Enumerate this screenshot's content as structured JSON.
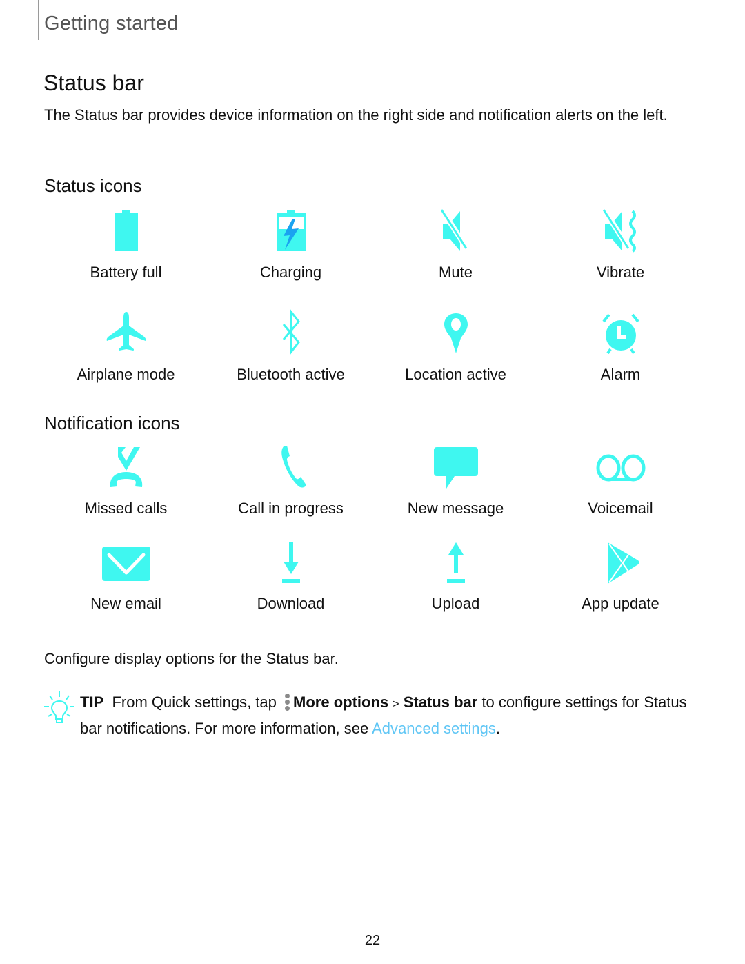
{
  "header": {
    "chapter": "Getting started"
  },
  "page": {
    "title": "Status bar",
    "intro": "The Status bar provides device information on the right side and notification alerts on the left.",
    "number": "22"
  },
  "colors": {
    "icon": "#3ff7f0",
    "accent_bolt": "#1aa3f0",
    "link": "#5fc6f5"
  },
  "status_icons": {
    "heading": "Status icons",
    "items": [
      {
        "label": "Battery full",
        "icon": "battery-full-icon"
      },
      {
        "label": "Charging",
        "icon": "charging-icon"
      },
      {
        "label": "Mute",
        "icon": "mute-icon"
      },
      {
        "label": "Vibrate",
        "icon": "vibrate-icon"
      },
      {
        "label": "Airplane mode",
        "icon": "airplane-icon"
      },
      {
        "label": "Bluetooth active",
        "icon": "bluetooth-icon"
      },
      {
        "label": "Location active",
        "icon": "location-icon"
      },
      {
        "label": "Alarm",
        "icon": "alarm-icon"
      }
    ]
  },
  "notification_icons": {
    "heading": "Notification icons",
    "items": [
      {
        "label": "Missed calls",
        "icon": "missed-call-icon"
      },
      {
        "label": "Call in progress",
        "icon": "phone-icon"
      },
      {
        "label": "New message",
        "icon": "message-icon"
      },
      {
        "label": "Voicemail",
        "icon": "voicemail-icon"
      },
      {
        "label": "New email",
        "icon": "email-icon"
      },
      {
        "label": "Download",
        "icon": "download-icon"
      },
      {
        "label": "Upload",
        "icon": "upload-icon"
      },
      {
        "label": "App update",
        "icon": "app-update-icon"
      }
    ]
  },
  "configure_text": "Configure display options for the Status bar.",
  "tip": {
    "label": "TIP",
    "text_1": "From Quick settings, tap",
    "more_options": "More options",
    "separator": ">",
    "status_bar": "Status bar",
    "text_2": "to configure settings for Status bar notifications. For more information, see",
    "link": "Advanced settings",
    "end": "."
  }
}
